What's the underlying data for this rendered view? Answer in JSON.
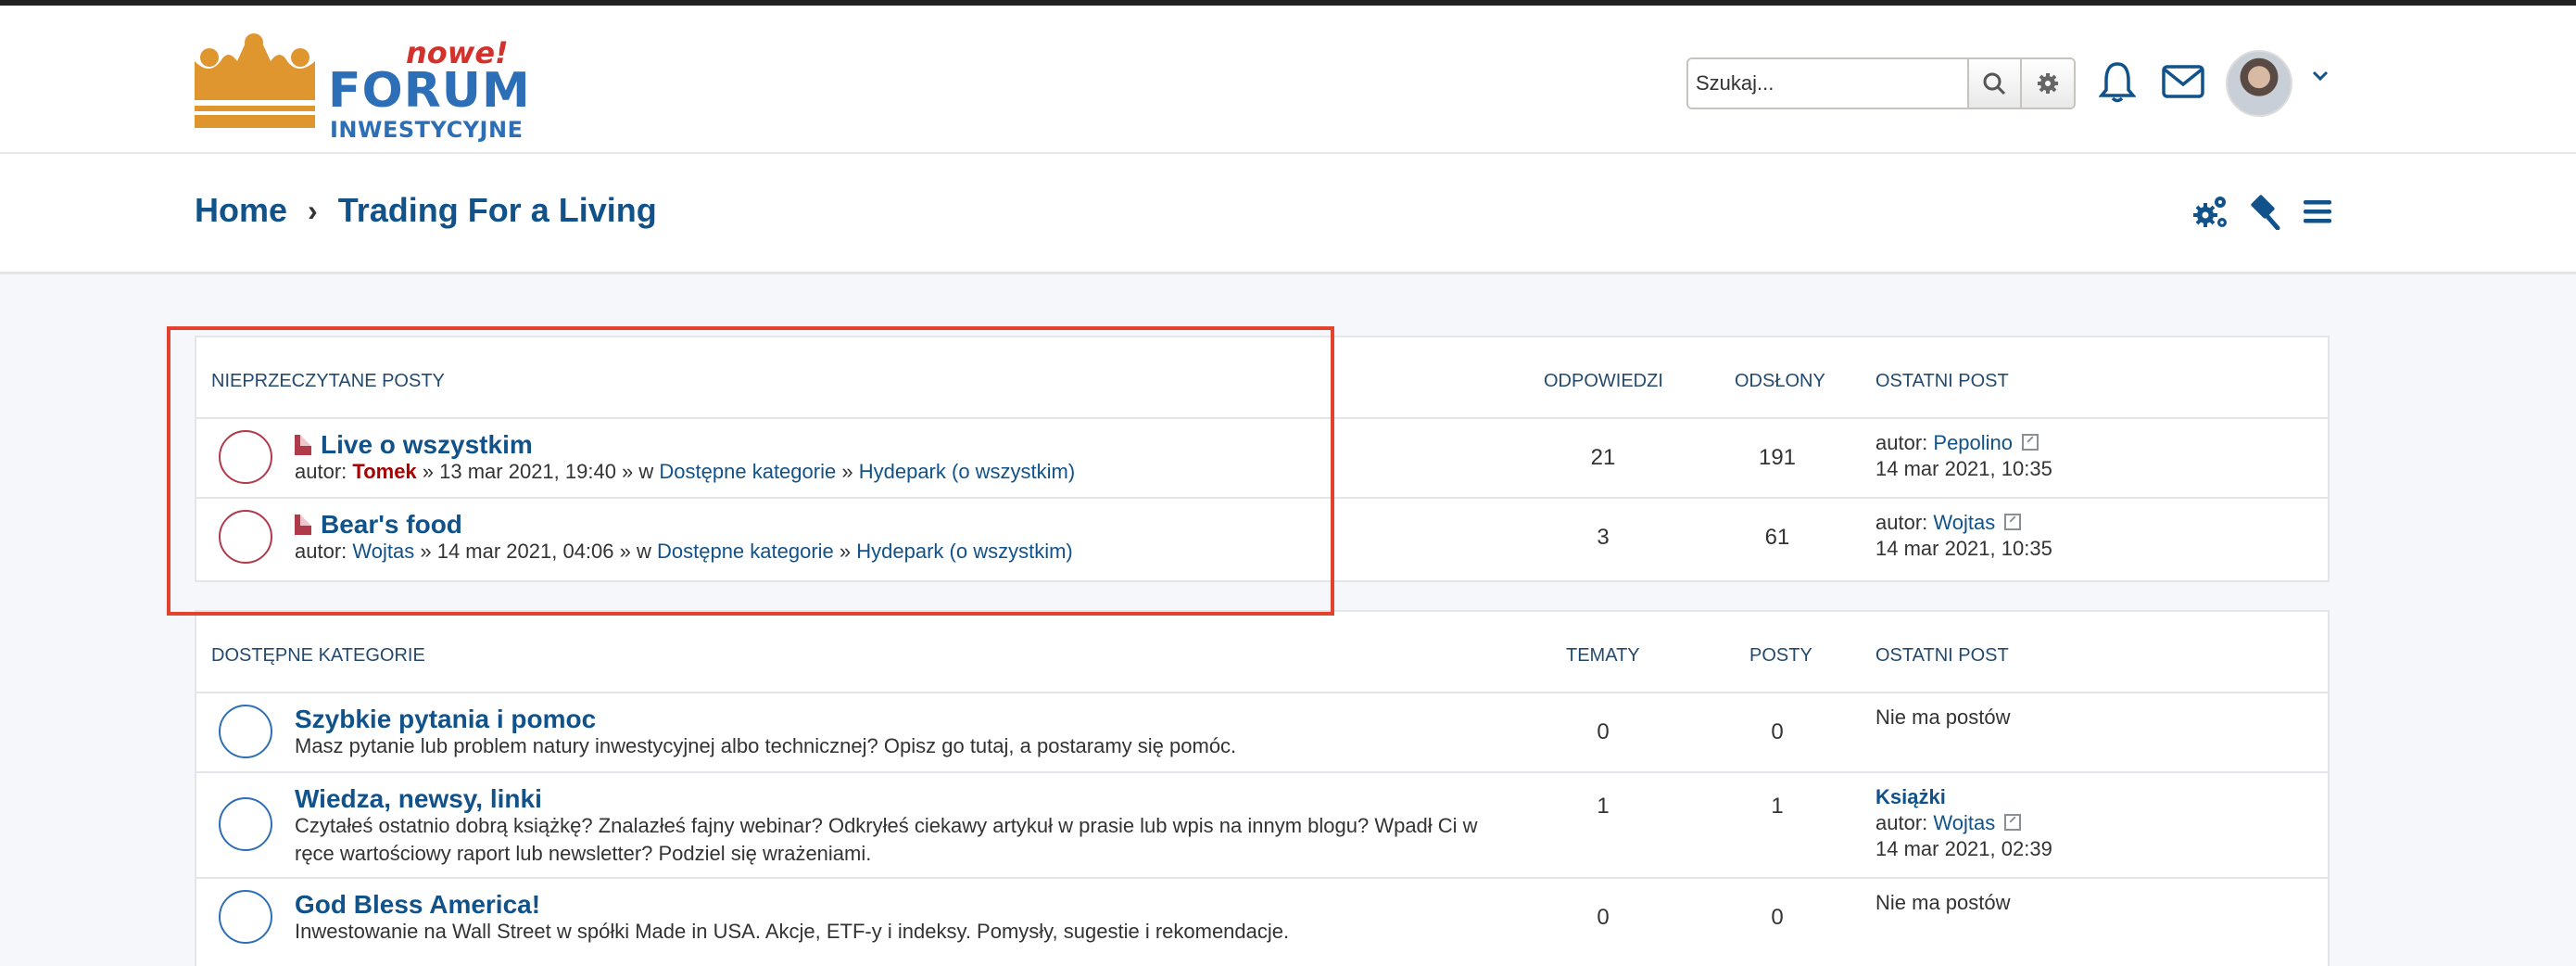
{
  "header": {
    "logo": {
      "nowe": "nowe!",
      "forum": "FORUM",
      "subtitle": "INWESTYCYJNE"
    },
    "search": {
      "placeholder": "Szukaj..."
    },
    "icons": [
      "search-icon",
      "gear-icon",
      "bell-icon",
      "envelope-icon",
      "avatar",
      "chevron-down-icon"
    ]
  },
  "breadcrumb": {
    "home": "Home",
    "separator": "›",
    "current": "Trading For a Living"
  },
  "navbar_icons": [
    "moderator-cogs-icon",
    "gavel-icon",
    "hamburger-menu-icon"
  ],
  "colors": {
    "accent": "#105289",
    "highlight_box": "#e2432e",
    "unread_circle": "#b03a4a",
    "read_circle": "#2d6fb7",
    "author_red": "#aa0000"
  },
  "unread": {
    "header": {
      "title": "NIEPRZECZYTANE POSTY",
      "replies": "ODPOWIEDZI",
      "views": "ODSŁONY",
      "last": "OSTATNI POST"
    },
    "rows": [
      {
        "title": "Live o wszystkim",
        "author_prefix": "autor:",
        "author": "Tomek",
        "meta": "» 13 mar 2021, 19:40 » w",
        "cat1": "Dostępne kategorie",
        "sep": "»",
        "cat2": "Hydepark (o wszystkim)",
        "replies": "21",
        "views": "191",
        "last_prefix": "autor:",
        "last_author": "Pepolino",
        "last_date": "14 mar 2021, 10:35"
      },
      {
        "title": "Bear's food",
        "author_prefix": "autor:",
        "author": "Wojtas",
        "meta": "» 14 mar 2021, 04:06 » w",
        "cat1": "Dostępne kategorie",
        "sep": "»",
        "cat2": "Hydepark (o wszystkim)",
        "replies": "3",
        "views": "61",
        "last_prefix": "autor:",
        "last_author": "Wojtas",
        "last_date": "14 mar 2021, 10:35"
      }
    ]
  },
  "categories": {
    "header": {
      "title": "DOSTĘPNE KATEGORIE",
      "topics": "TEMATY",
      "posts": "POSTY",
      "last": "OSTATNI POST"
    },
    "rows": [
      {
        "title": "Szybkie pytania i pomoc",
        "desc1": "Masz pytanie lub problem natury inwestycyjnej albo technicznej? Opisz go tutaj, a postaramy się pomóc.",
        "topics": "0",
        "posts": "0",
        "last": "Nie ma postów"
      },
      {
        "title": "Wiedza, newsy, linki",
        "desc1": "Czytałeś ostatnio dobrą książkę? Znalazłeś fajny webinar? Odkryłeś ciekawy artykuł w prasie lub wpis na innym blogu? Wpadł Ci w",
        "desc2": "ręce wartościowy raport lub newsletter? Podziel się wrażeniami.",
        "topics": "1",
        "posts": "1",
        "last_topic": "Książki",
        "last_prefix": "autor:",
        "last_author": "Wojtas",
        "last_date": "14 mar 2021, 02:39"
      },
      {
        "title": "God Bless America!",
        "desc1": "Inwestowanie na Wall Street w spółki Made in USA. Akcje, ETF-y i indeksy. Pomysły, sugestie i rekomendacje.",
        "topics": "0",
        "posts": "0",
        "last": "Nie ma postów"
      }
    ]
  }
}
